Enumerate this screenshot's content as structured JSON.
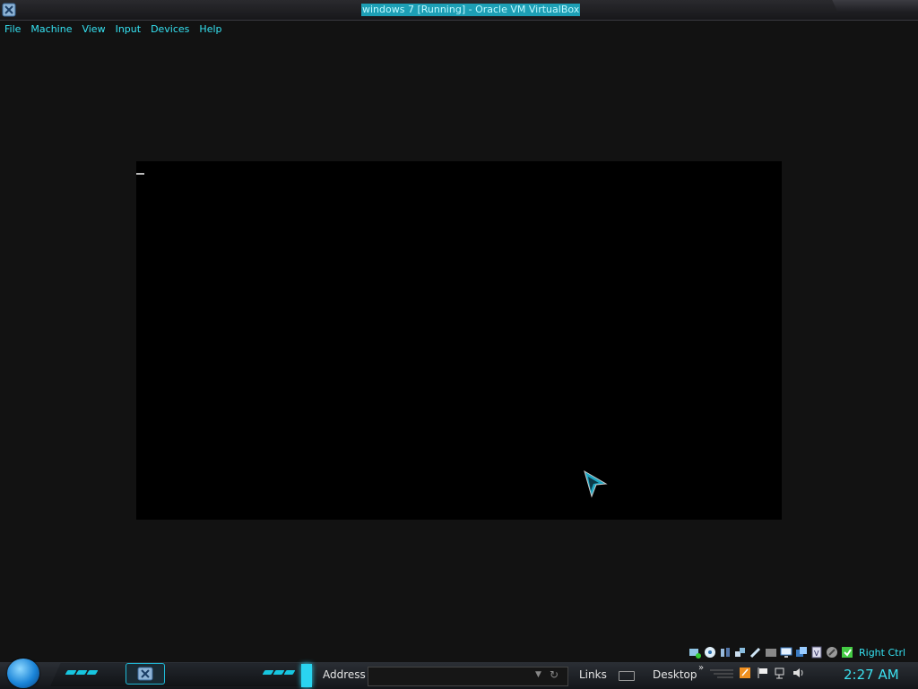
{
  "window": {
    "title": "windows 7 [Running] - Oracle VM VirtualBox"
  },
  "menu": [
    "File",
    "Machine",
    "View",
    "Input",
    "Devices",
    "Help"
  ],
  "status_bar": {
    "host_key": "Right Ctrl"
  },
  "taskbar": {
    "address_label": "Address",
    "address_value": "",
    "links_label": "Links",
    "desktop_label": "Desktop",
    "chevron": "»",
    "clock": "2:27 AM"
  },
  "colors": {
    "accent": "#35e2f2",
    "background": "#121212",
    "vm_screen": "#000000"
  },
  "icons": {
    "status_bar": [
      "hard-disk-icon",
      "optical-drive-icon",
      "audio-icon",
      "network-icon",
      "usb-icon",
      "shared-folders-icon",
      "display-icon",
      "video-capture-icon",
      "cpu-icon",
      "mouse-integration-icon",
      "host-key-icon"
    ],
    "tray": [
      "flag-icon",
      "network-icon",
      "volume-icon"
    ]
  }
}
